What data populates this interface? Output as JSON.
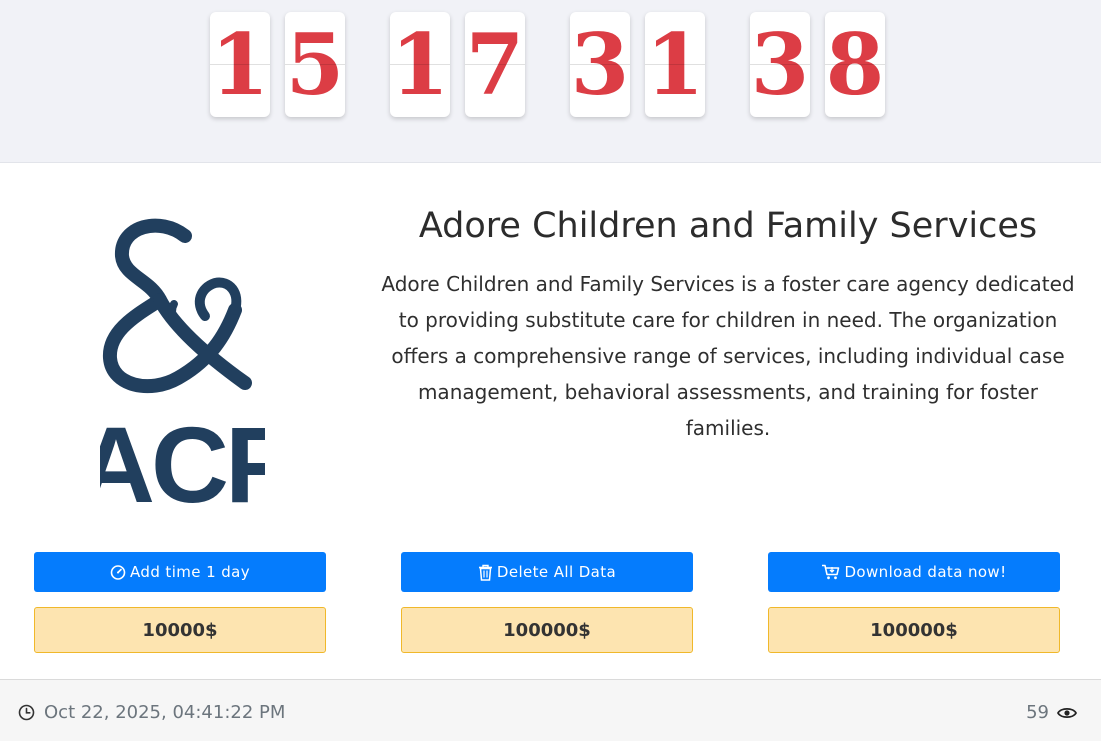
{
  "countdown": {
    "digits": [
      "1",
      "5",
      "1",
      "7",
      "3",
      "1",
      "3",
      "8"
    ]
  },
  "organization": {
    "logo_text": "ACF",
    "name": "Adore Children and Family Services",
    "description": "Adore Children and Family Services is a foster care agency dedicated to providing substitute care for children in need. The organization offers a comprehensive range of services, including individual case management, behavioral assessments, and training for foster families."
  },
  "actions": [
    {
      "label": "Add time 1 day",
      "icon": "timer-icon",
      "price": "10000$"
    },
    {
      "label": "Delete All Data",
      "icon": "trash-icon",
      "price": "100000$"
    },
    {
      "label": "Download data now!",
      "icon": "cart-icon",
      "price": "100000$"
    }
  ],
  "footer": {
    "timestamp": "Oct 22, 2025, 04:41:22 PM",
    "view_count": "59"
  },
  "colors": {
    "digit": "#dc3d45",
    "button": "#057cfd",
    "price_bg": "#fde4b0",
    "price_border": "#f0b82a",
    "logo": "#213f5e"
  }
}
